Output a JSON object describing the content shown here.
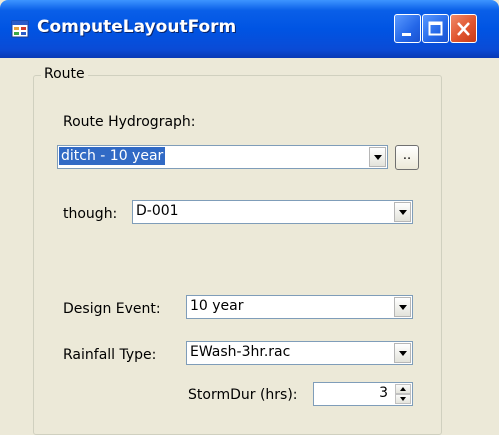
{
  "window": {
    "title": "ComputeLayoutForm",
    "app_icon": "form-icon",
    "controls": [
      "minimize-icon",
      "maximize-icon",
      "close-icon"
    ]
  },
  "route_group": {
    "legend": "Route",
    "route_hydrograph": {
      "label": "Route Hydrograph:",
      "selected": "ditch - 10 year",
      "browse_label": ".."
    },
    "through": {
      "label": "though:",
      "selected": "D-001"
    },
    "design_event": {
      "label": "Design Event:",
      "selected": "10 year"
    },
    "rainfall_type": {
      "label": "Rainfall Type:",
      "selected": "EWash-3hr.rac"
    },
    "storm_dur": {
      "label": "StormDur (hrs):",
      "value": "3"
    }
  },
  "colors": {
    "titlebar": "#0054e3",
    "window_bg": "#ece9d8",
    "selection": "#316ac5",
    "close_button": "#e0552f"
  }
}
